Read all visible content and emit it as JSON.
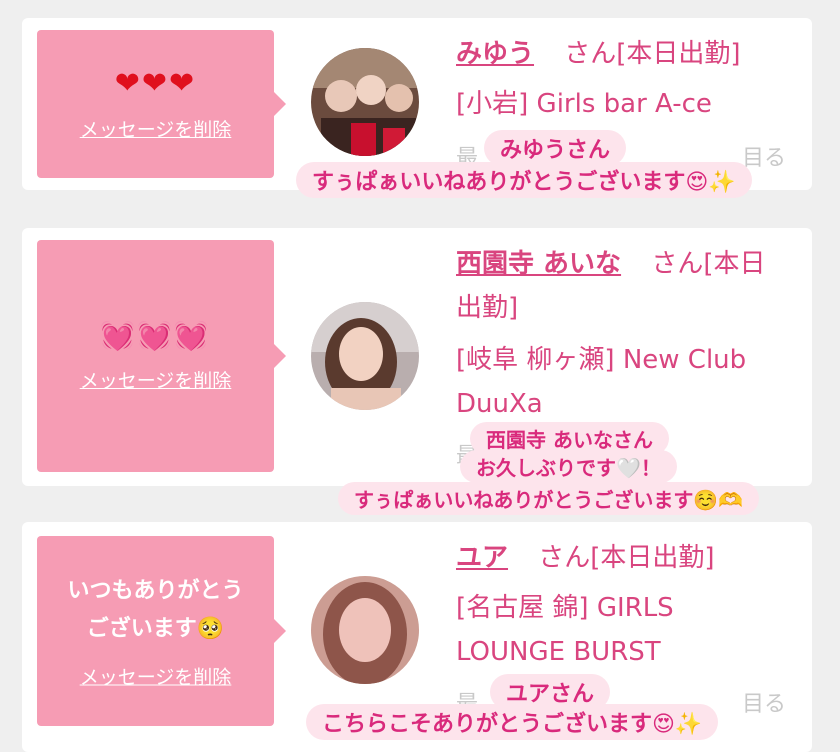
{
  "cards": [
    {
      "bubble_text": "",
      "hearts": "❤❤❤",
      "delete_label": "メッセージを削除",
      "name": "みゆう",
      "suffix": "さん[本日出勤]",
      "shop_lines": [
        "[小岩] Girls bar A-ce"
      ],
      "faint_text": "最　　　　　　　　　　　　目る",
      "captions": [
        "みゆうさん",
        "すぅぱぁいいねありがとうございます😍✨"
      ]
    },
    {
      "bubble_text": "",
      "hearts": "💓💓💓",
      "delete_label": "メッセージを削除",
      "name": "西園寺 あいな",
      "suffix": "さん[本日",
      "suffix2": "出勤]",
      "shop_lines": [
        "[岐阜 柳ヶ瀬] New Club",
        "DuuXa"
      ],
      "faint_text": "最",
      "captions": [
        "西園寺 あいなさん",
        "お久しぶりです🤍！",
        "すぅぱぁいいねありがとうございます☺️🫶"
      ]
    },
    {
      "bubble_text_line1": "いつもありがとう",
      "bubble_text_line2": "ございます🥺",
      "delete_label": "メッセージを削除",
      "name": "ユア",
      "suffix": "さん[本日出勤]",
      "shop_lines": [
        "[名古屋 錦] GIRLS",
        "LOUNGE BURST"
      ],
      "faint_text": "最　　　　　　　　　　　　目る",
      "captions": [
        "ユアさん",
        "こちらこそありがとうございます😍✨"
      ]
    }
  ]
}
